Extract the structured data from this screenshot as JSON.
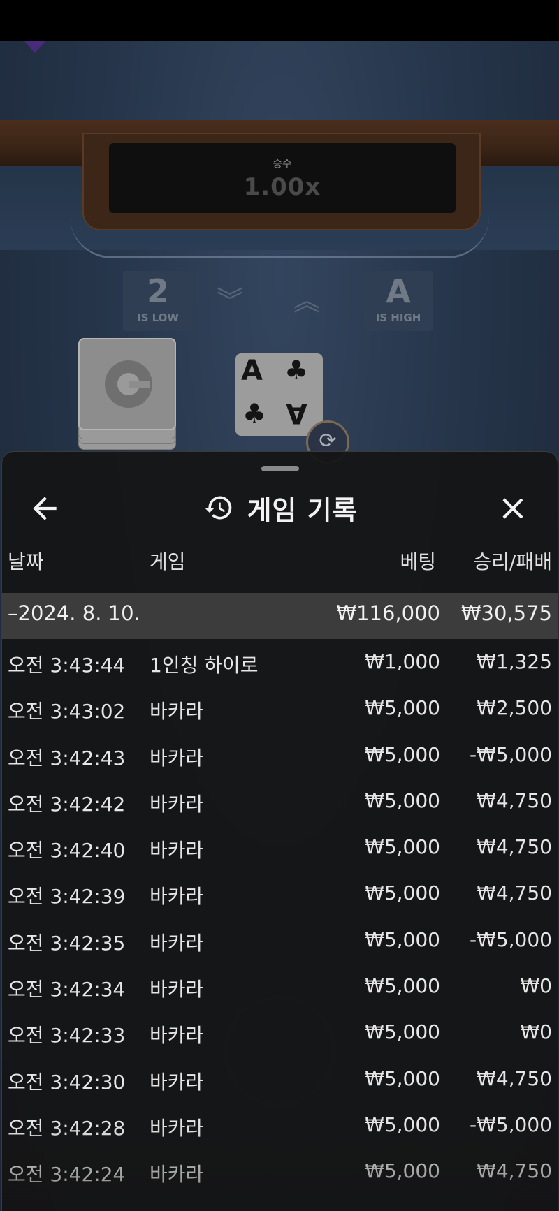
{
  "game_bg": {
    "multiplier_label": "승수",
    "multiplier_value": "1.00x",
    "low_rank": "2",
    "low_label": "IS LOW",
    "high_rank": "A",
    "high_label": "IS HIGH",
    "current_card": {
      "rank": "A",
      "suit": "♣"
    }
  },
  "sheet": {
    "title": "게임 기록",
    "icons": {
      "back": "arrow-left-icon",
      "history": "history-icon",
      "close": "close-icon"
    },
    "columns": {
      "date": "날짜",
      "game": "게임",
      "bet": "베팅",
      "result": "승리/패배"
    },
    "date_group": {
      "date": "–2024. 8. 10.",
      "bet_total": "₩116,000",
      "result_total": "₩30,575"
    },
    "rows": [
      {
        "time": "오전 3:43:44",
        "game": "1인칭 하이로",
        "bet": "₩1,000",
        "result": "₩1,325"
      },
      {
        "time": "오전 3:43:02",
        "game": "바카라",
        "bet": "₩5,000",
        "result": "₩2,500"
      },
      {
        "time": "오전 3:42:43",
        "game": "바카라",
        "bet": "₩5,000",
        "result": "-₩5,000"
      },
      {
        "time": "오전 3:42:42",
        "game": "바카라",
        "bet": "₩5,000",
        "result": "₩4,750"
      },
      {
        "time": "오전 3:42:40",
        "game": "바카라",
        "bet": "₩5,000",
        "result": "₩4,750"
      },
      {
        "time": "오전 3:42:39",
        "game": "바카라",
        "bet": "₩5,000",
        "result": "₩4,750"
      },
      {
        "time": "오전 3:42:35",
        "game": "바카라",
        "bet": "₩5,000",
        "result": "-₩5,000"
      },
      {
        "time": "오전 3:42:34",
        "game": "바카라",
        "bet": "₩5,000",
        "result": "₩0"
      },
      {
        "time": "오전 3:42:33",
        "game": "바카라",
        "bet": "₩5,000",
        "result": "₩0"
      },
      {
        "time": "오전 3:42:30",
        "game": "바카라",
        "bet": "₩5,000",
        "result": "₩4,750"
      },
      {
        "time": "오전 3:42:28",
        "game": "바카라",
        "bet": "₩5,000",
        "result": "-₩5,000"
      },
      {
        "time": "오전 3:42:24",
        "game": "바카라",
        "bet": "₩5,000",
        "result": "₩4,750"
      }
    ]
  },
  "colors": {
    "sheet_bg": "#141414",
    "date_row_bg": "#3c3c3c",
    "text": "#e6e6e6"
  }
}
